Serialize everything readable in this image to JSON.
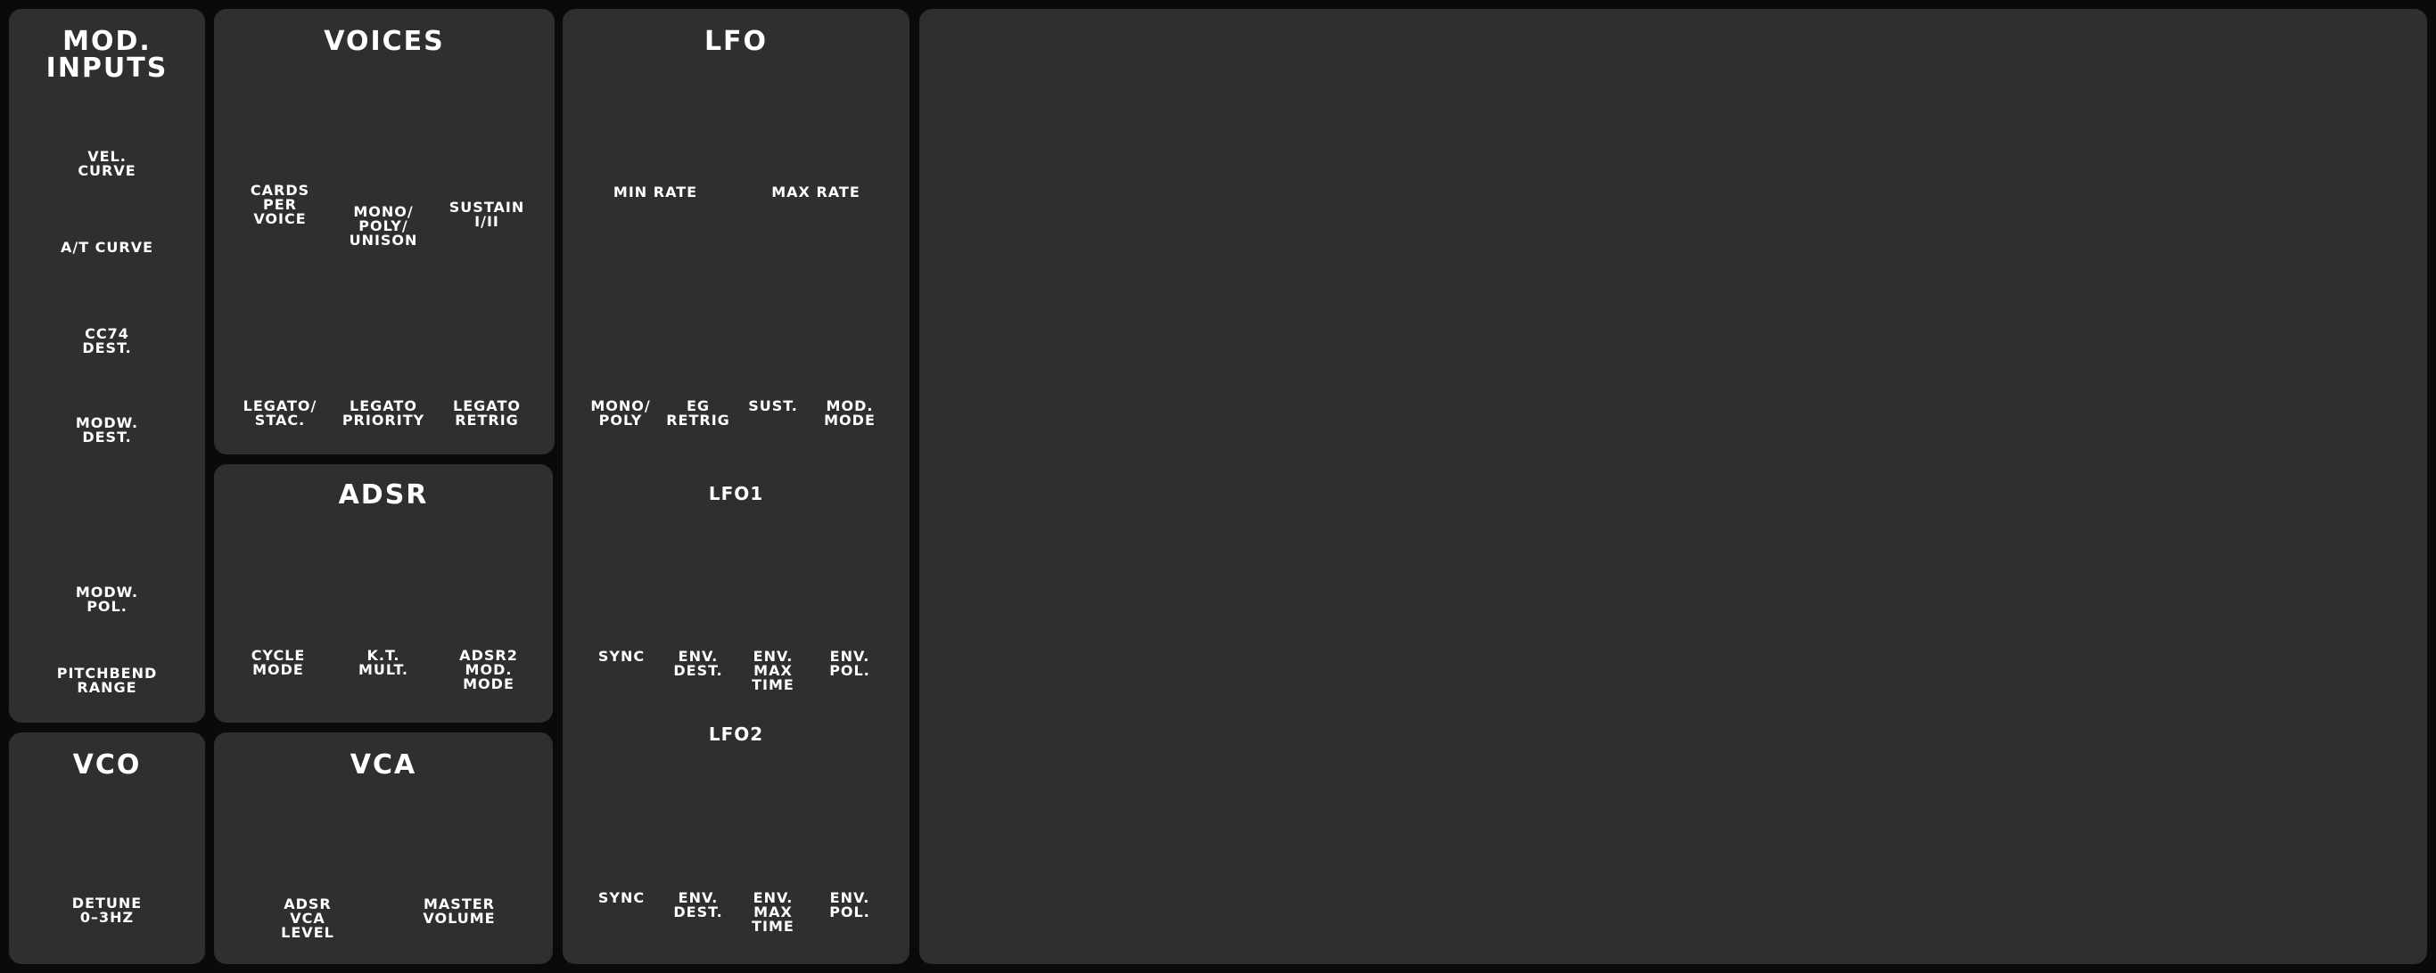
{
  "panels": {
    "mod_inputs": {
      "title": "MOD.\nINPUTS",
      "labels": [
        "VEL. CURVE",
        "A/T CURVE",
        "CC74 DEST.",
        "MODW. DEST.",
        "MODW. POL.",
        "PITCHBEND\nRANGE"
      ]
    },
    "voices": {
      "title": "VOICES",
      "labels": [
        "CARDS\nPER\nVOICE",
        "MONO/\nPOLY/\nUNISON",
        "SUSTAIN\nI/II",
        "LEGATO/\nSTAC.",
        "LEGATO\nPRIORITY",
        "LEGATO\nRETRIG"
      ]
    },
    "adsr": {
      "title": "ADSR",
      "labels": [
        "CYCLE\nMODE",
        "K.T.\nMULT.",
        "ADSR2\nMOD.\nMODE"
      ]
    },
    "vco": {
      "title": "VCO",
      "labels": [
        "DETUNE\n0–3HZ"
      ]
    },
    "vca": {
      "title": "VCA",
      "labels": [
        "ADSR\nVCA\nLEVEL",
        "MASTER\nVOLUME"
      ]
    },
    "lfo": {
      "title": "LFO",
      "labels": [
        "MIN RATE",
        "MAX RATE",
        "MONO/\nPOLY",
        "EG\nRETRIG",
        "SUST.",
        "MOD.\nMODE"
      ],
      "lfo1": {
        "title": "LFO1",
        "labels": [
          "SYNC",
          "ENV.\nDEST.",
          "ENV.\nMAX\nTIME",
          "ENV.\nPOL."
        ]
      },
      "lfo2": {
        "title": "LFO2",
        "labels": [
          "SYNC",
          "ENV.\nDEST.",
          "ENV.\nMAX\nTIME",
          "ENV.\nPOL."
        ]
      }
    }
  },
  "colors": {
    "background": "#0a0a0a",
    "panel": "#2f2f2f",
    "text": "#ffffff"
  }
}
